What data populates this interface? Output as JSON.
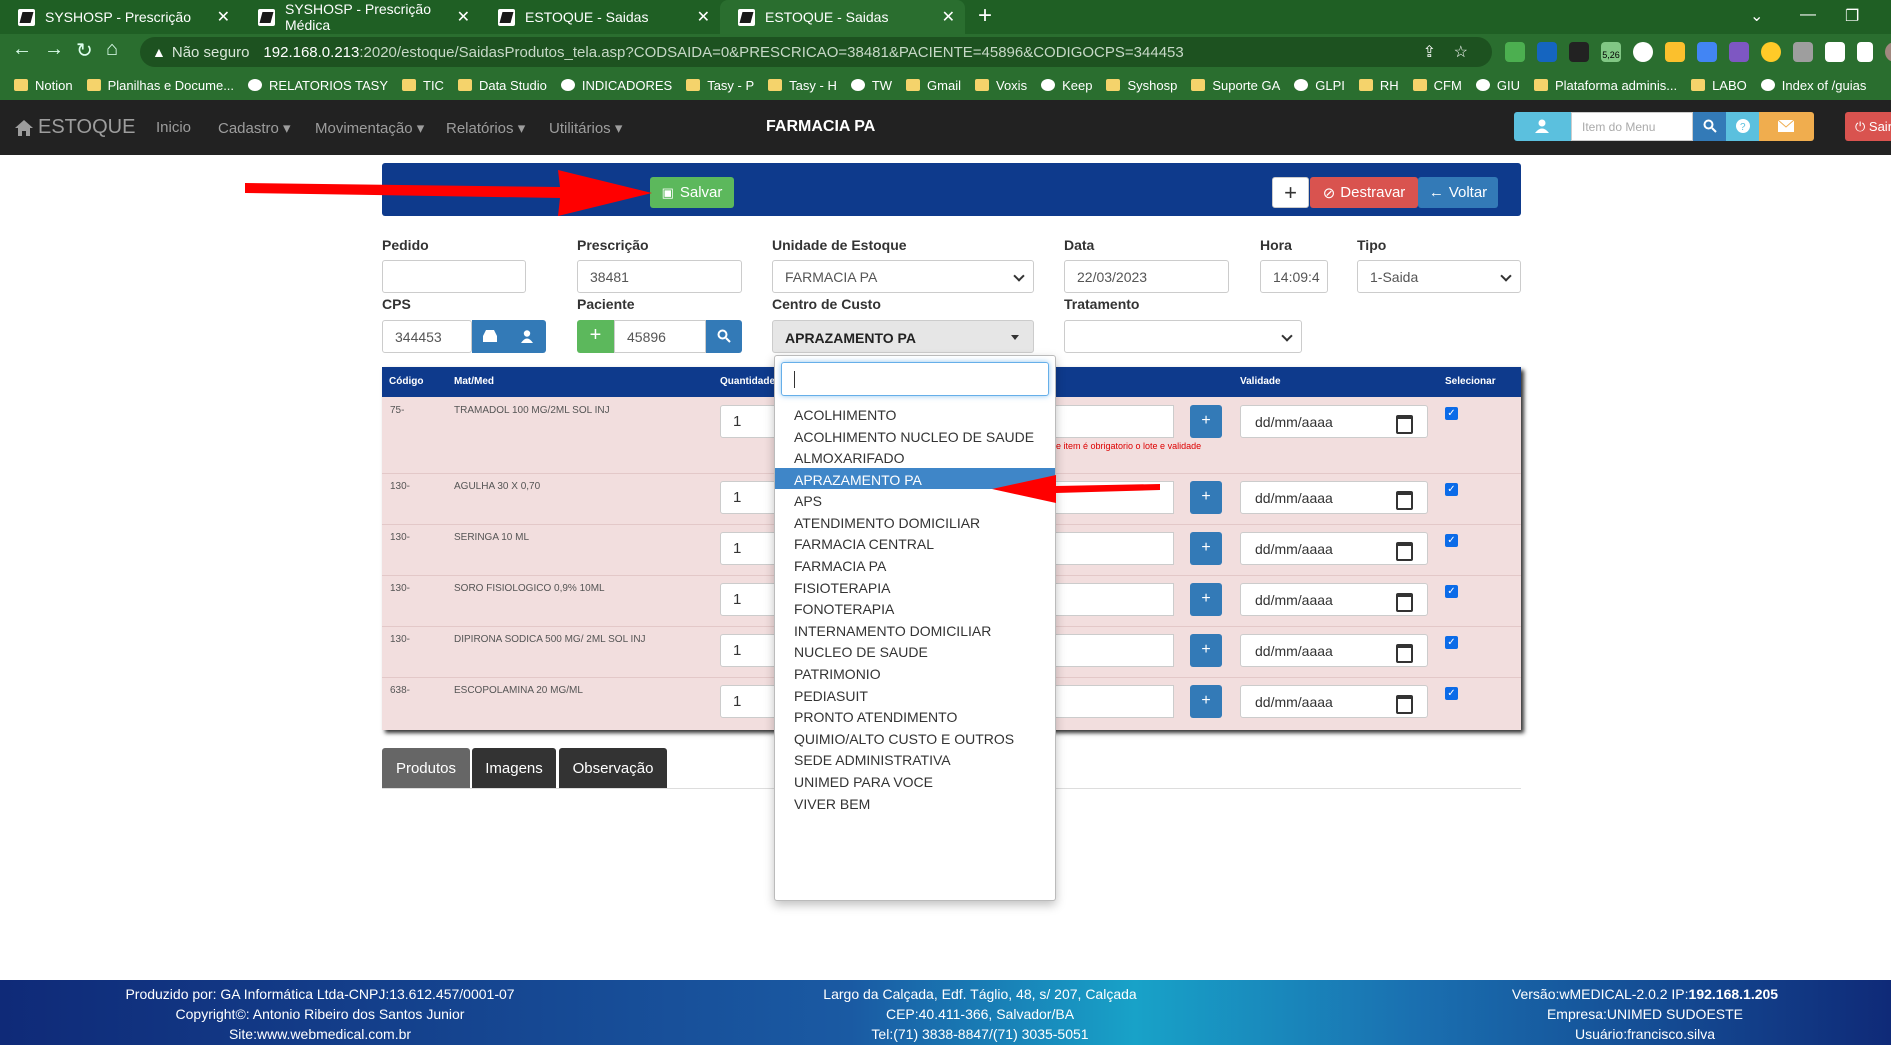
{
  "browser": {
    "tabs": [
      {
        "title": "SYSHOSP - Prescrição"
      },
      {
        "title": "SYSHOSP - Prescrição Médica"
      },
      {
        "title": "ESTOQUE - Saidas"
      },
      {
        "title": "ESTOQUE - Saidas"
      }
    ],
    "security": "Não seguro",
    "url_host": "192.168.0.213",
    "url_path": ":2020/estoque/SaidasProdutos_tela.asp?CODSAIDA=0&PRESCRICAO=38481&PACIENTE=45896&CODIGOCPS=344453",
    "ext_badge": "5,26",
    "bookmarks": [
      "Notion",
      "Planilhas e Docume...",
      "RELATORIOS TASY",
      "TIC",
      "Data Studio",
      "INDICADORES",
      "Tasy - P",
      "Tasy - H",
      "TW",
      "Gmail",
      "Voxis",
      "Keep",
      "Syshosp",
      "Suporte GA",
      "GLPI",
      "RH",
      "CFM",
      "GIU",
      "Plataforma adminis...",
      "LABO",
      "Index of /guias"
    ]
  },
  "app": {
    "brand": "ESTOQUE",
    "nav": [
      "Inicio",
      "Cadastro",
      "Movimentação",
      "Relatórios",
      "Utilitários"
    ],
    "center_title": "FARMACIA PA",
    "menu_placeholder": "Item do Menu",
    "sair": "Sair"
  },
  "toolbar": {
    "save": "Salvar",
    "plus": "+",
    "destravar": "Destravar",
    "voltar": "Voltar"
  },
  "form": {
    "pedido_label": "Pedido",
    "pedido": "",
    "prescricao_label": "Prescrição",
    "prescricao": "38481",
    "unidade_label": "Unidade de Estoque",
    "unidade": "FARMACIA PA",
    "data_label": "Data",
    "data": "22/03/2023",
    "hora_label": "Hora",
    "hora": "14:09:4",
    "tipo_label": "Tipo",
    "tipo": "1-Saida",
    "cps_label": "CPS",
    "cps": "344453",
    "paciente_label": "Paciente",
    "paciente": "45896",
    "centro_label": "Centro de Custo",
    "centro": "APRAZAMENTO PA",
    "tratamento_label": "Tratamento",
    "tratamento": ""
  },
  "table": {
    "headers": [
      "Código",
      "Mat/Med",
      "Quantidade",
      "Validade",
      "Selecionar"
    ],
    "rows": [
      {
        "codigo": "75-",
        "med": "TRAMADOL 100 MG/2ML SOL INJ",
        "qtd": "1",
        "validade": "dd/mm/aaaa",
        "checked": true,
        "warning": "sse item é obrigatorio o lote e validade"
      },
      {
        "codigo": "130-",
        "med": "AGULHA 30 X 0,70",
        "qtd": "1",
        "validade": "dd/mm/aaaa",
        "checked": true
      },
      {
        "codigo": "130-",
        "med": "SERINGA 10 ML",
        "qtd": "1",
        "validade": "dd/mm/aaaa",
        "checked": true
      },
      {
        "codigo": "130-",
        "med": "SORO FISIOLOGICO 0,9% 10ML",
        "qtd": "1",
        "validade": "dd/mm/aaaa",
        "checked": true
      },
      {
        "codigo": "130-",
        "med": "DIPIRONA SODICA 500 MG/ 2ML SOL INJ",
        "qtd": "1",
        "validade": "dd/mm/aaaa",
        "checked": true
      },
      {
        "codigo": "638-",
        "med": "ESCOPOLAMINA 20 MG/ML",
        "qtd": "1",
        "validade": "dd/mm/aaaa",
        "checked": true
      }
    ]
  },
  "bottom_tabs": [
    "Produtos",
    "Imagens",
    "Observação"
  ],
  "dropdown": {
    "options": [
      "ACOLHIMENTO",
      "ACOLHIMENTO NUCLEO DE SAUDE",
      "ALMOXARIFADO",
      "APRAZAMENTO PA",
      "APS",
      "ATENDIMENTO DOMICILIAR",
      "FARMACIA CENTRAL",
      "FARMACIA PA",
      "FISIOTERAPIA",
      "FONOTERAPIA",
      "INTERNAMENTO DOMICILIAR",
      "NUCLEO DE SAUDE",
      "PATRIMONIO",
      "PEDIASUIT",
      "PRONTO ATENDIMENTO",
      "QUIMIO/ALTO CUSTO E OUTROS",
      "SEDE ADMINISTRATIVA",
      "UNIMED PARA VOCE",
      "VIVER BEM"
    ],
    "selected": "APRAZAMENTO PA"
  },
  "footer": {
    "left": [
      "Produzido por: GA Informática Ltda-CNPJ:13.612.457/0001-07",
      "Copyright©: Antonio Ribeiro dos Santos Junior",
      "Site:www.webmedical.com.br"
    ],
    "center": [
      "Largo da Calçada, Edf. Táglio, 48, s/ 207, Calçada",
      "CEP:40.411-366, Salvador/BA",
      "Tel:(71) 3838-8847/(71) 3035-5051"
    ],
    "right_version": "Versão:wMEDICAL-2.0.2 IP:",
    "right_ip": "192.168.1.205",
    "right_empresa": "Empresa:UNIMED SUDOESTE",
    "right_usuario": "Usuário:francisco.silva"
  },
  "colors": {
    "navbar": "#222222",
    "header_bar": "#0e3a8c",
    "table_bg": "#f2dede",
    "arrow": "#ff0000"
  }
}
